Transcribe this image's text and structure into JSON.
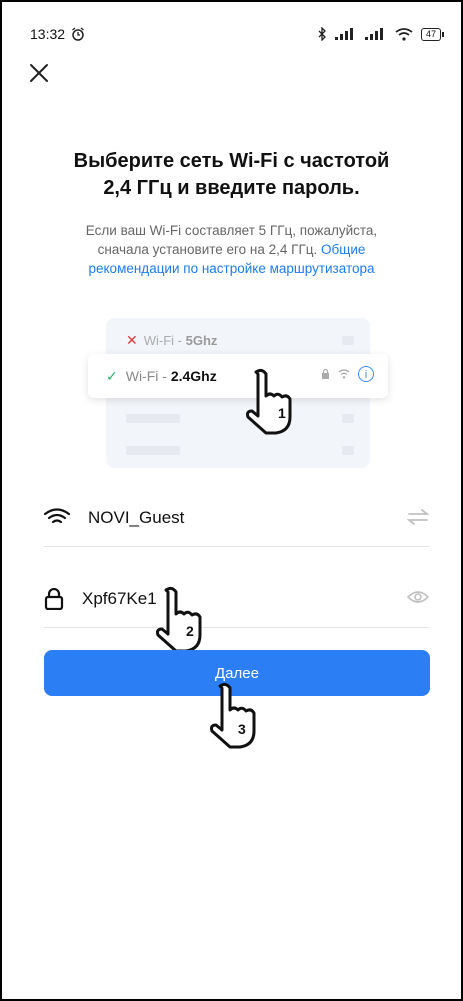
{
  "status_bar": {
    "time": "13:32",
    "battery": "47"
  },
  "page": {
    "title_line1": "Выберите сеть Wi-Fi с частотой",
    "title_line2": "2,4 ГГц и введите пароль.",
    "desc_line1": "Если ваш Wi-Fi составляет 5 ГГц, пожалуйста,",
    "desc_line2_text": "сначала установите его на 2,4 ГГц. ",
    "desc_line2_link": "Общие",
    "desc_line3_link": "рекомендации по настройке маршрутизатора"
  },
  "illustration": {
    "row5_prefix": "Wi-Fi - ",
    "row5_band": "5Ghz",
    "row24_prefix": "Wi-Fi - ",
    "row24_band": "2.4Ghz",
    "info": "i"
  },
  "form": {
    "ssid": "NOVI_Guest",
    "password": "Xpf67Ke1"
  },
  "actions": {
    "next_label": "Далее"
  },
  "hints": {
    "step1": "1",
    "step2": "2",
    "step3": "3"
  },
  "colors": {
    "accent": "#2b7ef3",
    "link": "#1b7cf2",
    "check": "#27b36a",
    "cross": "#e03a3a"
  }
}
